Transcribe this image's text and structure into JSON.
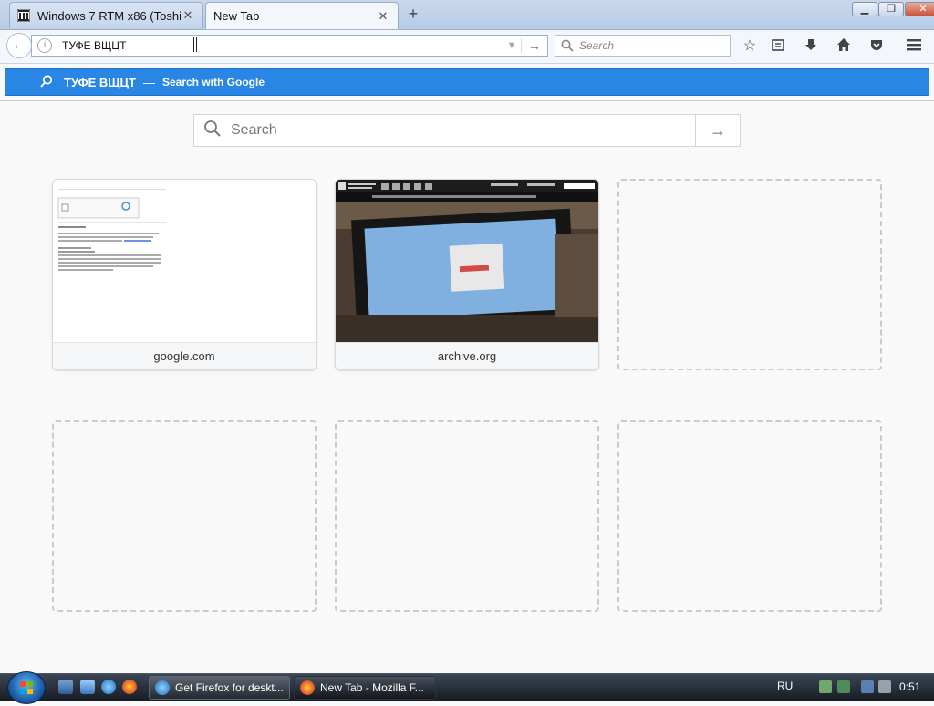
{
  "window": {
    "minimize": "▁",
    "restore": "❐",
    "close": "✕"
  },
  "tabs": [
    {
      "label": "Windows 7 RTM x86 (Toshi...",
      "close": "✕",
      "icon": "archive-icon"
    },
    {
      "label": "New Tab",
      "close": "✕"
    }
  ],
  "newtab_label": "+",
  "navbar": {
    "url_value": "ТУФЕ ВЩЦТ",
    "info": "i",
    "dropmarker": "▼",
    "go": "→",
    "search_placeholder": "Search",
    "toolbar_icons": [
      "bookmark-star-icon",
      "reading-list-icon",
      "downloads-icon",
      "home-icon",
      "pocket-icon",
      "menu-icon"
    ]
  },
  "suggestion": {
    "term": "ТУФЕ ВЩЦТ",
    "separator": "—",
    "action": "Search with Google"
  },
  "content_search": {
    "placeholder": "Search",
    "go": "→"
  },
  "tiles": [
    {
      "title": "google.com",
      "filled": true
    },
    {
      "title": "archive.org",
      "filled": true
    },
    {
      "filled": false
    },
    {
      "filled": false
    },
    {
      "filled": false
    },
    {
      "filled": false
    }
  ],
  "taskbar": {
    "tasks": [
      {
        "label": "Get Firefox for deskt...",
        "icon": "ie-icon"
      },
      {
        "label": "New Tab - Mozilla F...",
        "icon": "firefox-icon"
      }
    ],
    "language": "RU",
    "clock": "0:51"
  },
  "colors": {
    "accent": "#2a86e4",
    "tab_bg": "#c9d8ec",
    "taskbar": "#1e252e"
  }
}
